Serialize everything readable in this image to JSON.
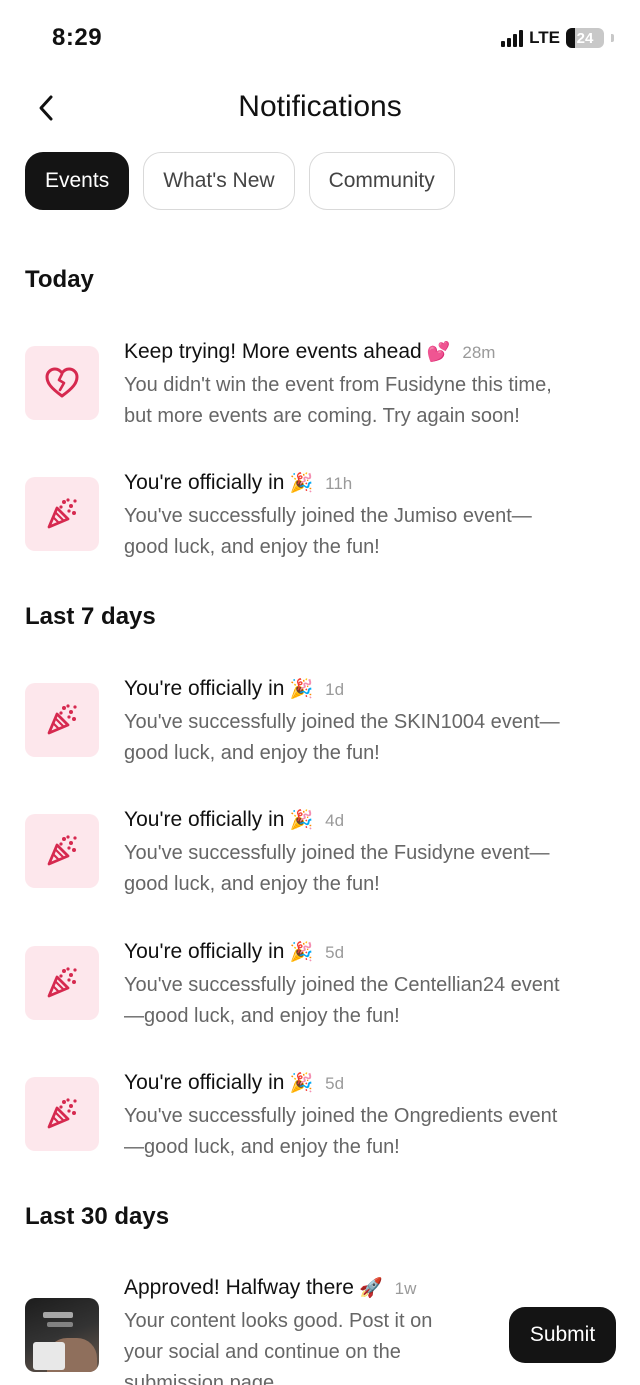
{
  "status_bar": {
    "time": "8:29",
    "network": "LTE",
    "battery": "24"
  },
  "header": {
    "title": "Notifications",
    "back_icon": "chevron-left-icon"
  },
  "tabs": [
    {
      "label": "Events",
      "active": true
    },
    {
      "label": "What's New",
      "active": false
    },
    {
      "label": "Community",
      "active": false
    }
  ],
  "sections": {
    "today": "Today",
    "last7": "Last 7 days",
    "last30": "Last 30 days"
  },
  "notifications": [
    {
      "icon": "broken-heart-icon",
      "title": "Keep trying! More events ahead",
      "emoji": "💕",
      "time": "28m",
      "body_1": "You didn't win the event from Fusidyne this time,",
      "body_2": "but more events are coming. Try again soon!"
    },
    {
      "icon": "party-popper-icon",
      "title": "You're officially in",
      "emoji": "🎉",
      "time": "11h",
      "body_1": "You've successfully joined the Jumiso event—",
      "body_2": "good luck, and enjoy the fun!"
    },
    {
      "icon": "party-popper-icon",
      "title": "You're officially in",
      "emoji": "🎉",
      "time": "1d",
      "body_1": "You've successfully joined the SKIN1004 event—",
      "body_2": "good luck, and enjoy the fun!"
    },
    {
      "icon": "party-popper-icon",
      "title": "You're officially in",
      "emoji": "🎉",
      "time": "4d",
      "body_1": "You've successfully joined the Fusidyne event—",
      "body_2": "good luck, and enjoy the fun!"
    },
    {
      "icon": "party-popper-icon",
      "title": "You're officially in",
      "emoji": "🎉",
      "time": "5d",
      "body_1": "You've successfully joined the Centellian24 event",
      "body_2": "—good luck, and enjoy the fun!"
    },
    {
      "icon": "party-popper-icon",
      "title": "You're officially in",
      "emoji": "🎉",
      "time": "5d",
      "body_1": "You've successfully joined the Ongredients event",
      "body_2": "—good luck, and enjoy the fun!"
    },
    {
      "icon": "content-thumbnail",
      "title": "Approved! Halfway there",
      "emoji": "🚀",
      "time": "1w",
      "body_1": "Your content looks good. Post it on",
      "body_2": "your social and continue on the",
      "body_3": "submission page"
    }
  ],
  "submit_button": {
    "label": "Submit"
  },
  "colors": {
    "accent": "#d6294f",
    "icon_bg": "#fde7ec",
    "dark": "#141414"
  }
}
